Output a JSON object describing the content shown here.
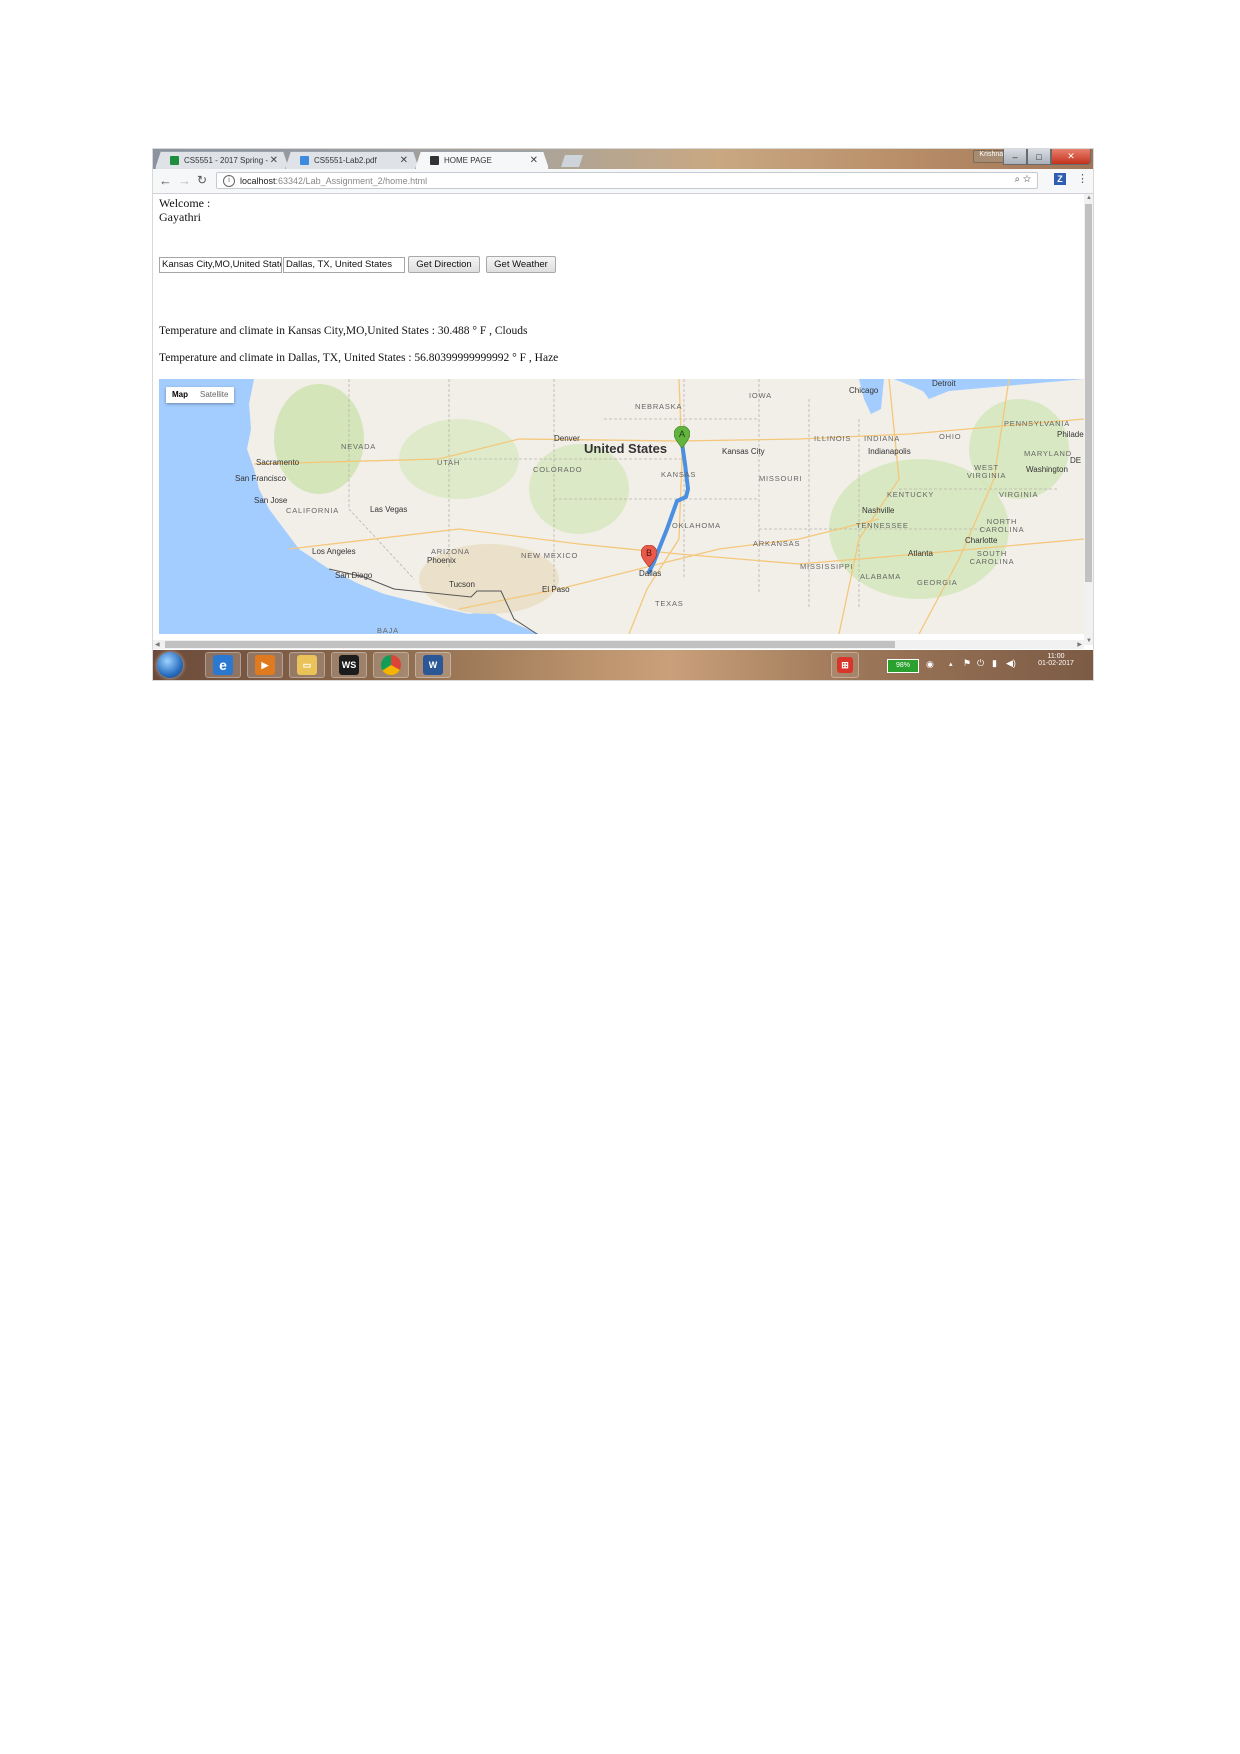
{
  "browser": {
    "tabs": [
      {
        "title": "CS5551 - 2017 Spring - ",
        "icon": "spreadsheet-icon",
        "color": "#1e8e3e"
      },
      {
        "title": "CS5551-Lab2.pdf",
        "icon": "dropbox-icon",
        "color": "#3d8ae0"
      },
      {
        "title": "HOME PAGE",
        "icon": "webstorm-icon",
        "color": "#333333"
      }
    ],
    "user_badge": "Krishnam",
    "address": {
      "host": "localhost",
      "path": ":63342/Lab_Assignment_2/home.html"
    },
    "extension_label": "Z"
  },
  "page": {
    "welcome_label": "Welcome :",
    "user_name": "Gayathri",
    "source_input": {
      "value": "Kansas City,MO,United States"
    },
    "destination_input": {
      "value": "Dallas, TX, United States"
    },
    "direction_button": "Get Direction",
    "weather_button": "Get Weather",
    "temperature_lines": [
      "Temperature and climate in Kansas City,MO,United States : 30.488 ° F , Clouds",
      "Temperature and climate in Dallas, TX, United States : 56.80399999999992 ° F , Haze"
    ]
  },
  "map": {
    "type_controls": {
      "map": "Map",
      "satellite": "Satellite"
    },
    "country_label": "United States",
    "state_labels": [
      "NEBRASKA",
      "IOWA",
      "NEVADA",
      "UTAH",
      "COLORADO",
      "KANSAS",
      "MISSOURI",
      "ILLINOIS",
      "INDIANA",
      "OHIO",
      "PENNSYLVANIA",
      "MARYLAND",
      "WEST VIRGINIA",
      "VIRGINIA",
      "KENTUCKY",
      "CALIFORNIA",
      "ARIZONA",
      "NEW MEXICO",
      "OKLAHOMA",
      "ARKANSAS",
      "TENNESSEE",
      "NORTH CAROLINA",
      "SOUTH CAROLINA",
      "MISSISSIPPI",
      "ALABAMA",
      "GEORGIA",
      "TEXAS",
      "BAJA"
    ],
    "city_labels": [
      "Chicago",
      "Detroit",
      "Philade",
      "Denver",
      "Kansas City",
      "Indianapolis",
      "Washington",
      "DE",
      "Sacramento",
      "San Francisco",
      "San Jose",
      "Las Vegas",
      "Los Angeles",
      "San Diego",
      "Phoenix",
      "Tucson",
      "El Paso",
      "Nashville",
      "Charlotte",
      "Atlanta",
      "Dallas"
    ],
    "markers": [
      {
        "label": "A"
      },
      {
        "label": "B"
      }
    ],
    "route_color": "#4a8fe0",
    "water_color": "#a3ccff",
    "land_color": "#f2efe9"
  },
  "taskbar": {
    "battery": "98%",
    "time": "11:00",
    "date": "01-02-2017",
    "apps": [
      "internet-explorer-icon",
      "media-player-icon",
      "file-explorer-icon",
      "webstorm-icon",
      "chrome-icon",
      "word-icon"
    ]
  }
}
